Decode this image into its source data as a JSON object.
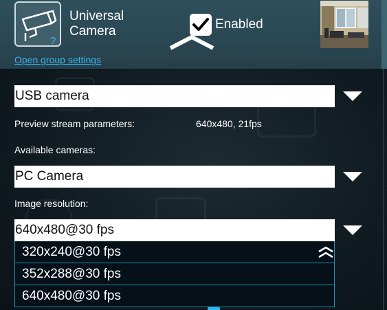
{
  "header": {
    "title_line1": "Universal",
    "title_line2": "Camera",
    "group_settings_link": "Open group settings",
    "enabled_label": "Enabled",
    "enabled_checked": true
  },
  "camera_type": {
    "selected": "USB camera"
  },
  "preview": {
    "label": "Preview stream parameters:",
    "value": "640x480, 21fps"
  },
  "available_cameras": {
    "label": "Available cameras:",
    "selected": "PC Camera"
  },
  "image_resolution": {
    "label": "Image resolution:",
    "selected": "640x480@30 fps",
    "options": [
      "320x240@30 fps",
      "352x288@30 fps",
      "640x480@30 fps"
    ]
  },
  "colors": {
    "header_bg": "#2e4f5c",
    "link": "#35b6ee",
    "dropdown_border": "#2a8db4"
  }
}
